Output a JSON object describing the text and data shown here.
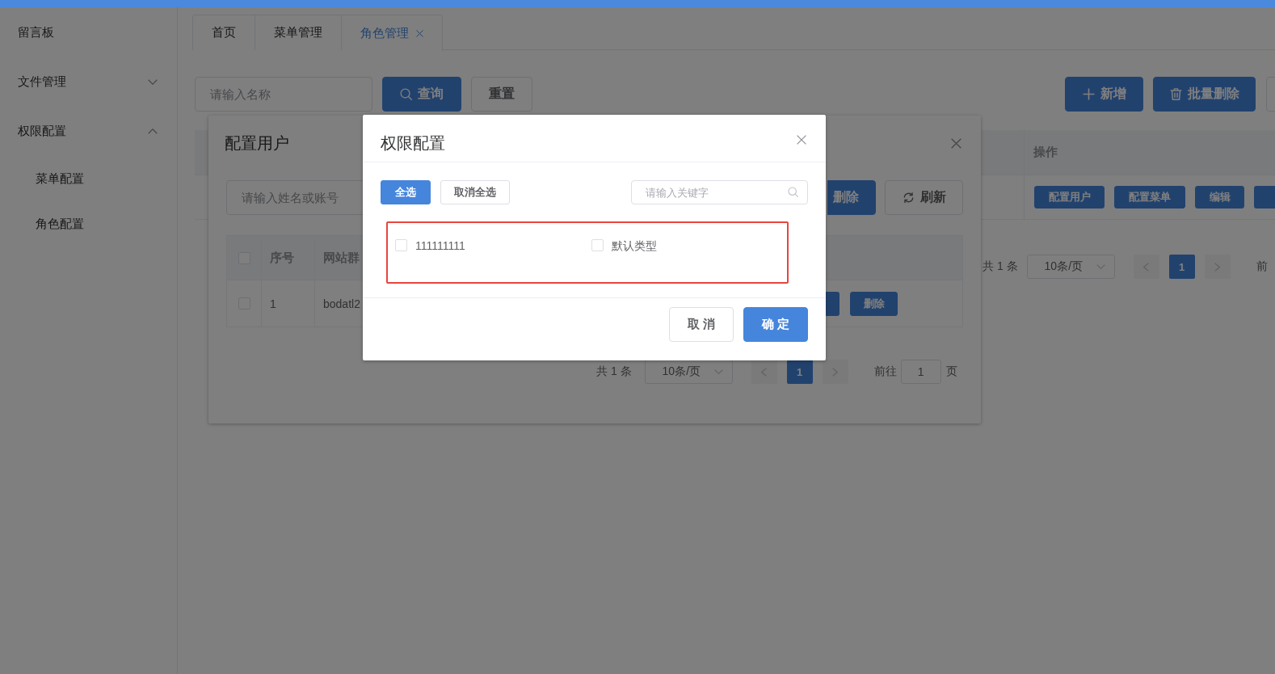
{
  "sidebar": {
    "items": [
      {
        "kind": "link",
        "label": "留言板"
      },
      {
        "kind": "submenu",
        "label": "文件管理",
        "expanded": false
      },
      {
        "kind": "submenu",
        "label": "权限配置",
        "expanded": true,
        "children": [
          {
            "label": "菜单配置"
          },
          {
            "label": "角色配置"
          }
        ]
      }
    ]
  },
  "tabs": [
    {
      "label": "首页",
      "selected": false,
      "closable": false
    },
    {
      "label": "菜单管理",
      "selected": false,
      "closable": false
    },
    {
      "label": "角色管理",
      "selected": true,
      "closable": true
    }
  ],
  "toolbar": {
    "search": {
      "placeholder": "请输入名称"
    },
    "buttons": [
      {
        "label": "查询",
        "kind": "search"
      },
      {
        "label": "重置",
        "kind": "plain"
      }
    ],
    "actions": [
      {
        "label": "新增",
        "kind": "add"
      },
      {
        "label": "批量删除",
        "kind": "delete"
      }
    ]
  },
  "table": {
    "columns": [
      "操作"
    ],
    "rows": [
      {
        "actions": [
          "配置用户",
          "配置菜单",
          "编辑"
        ]
      }
    ]
  },
  "pagination": {
    "total": "共 1 条",
    "page_size": "10条/页",
    "pages": [
      {
        "label": "1",
        "selected": true
      }
    ],
    "jump_label": "前"
  },
  "user_dialog": {
    "title": "配置用户",
    "search": {
      "placeholder": "请输入姓名或账号"
    },
    "buttons": [
      {
        "label": "删除",
        "kind": "primary"
      },
      {
        "label": "刷新",
        "kind": "refresh"
      }
    ],
    "table": {
      "header_checked": false,
      "columns": [
        "序号",
        "网站群"
      ],
      "rows": [
        {
          "checked": false,
          "cells": [
            "1",
            "bodatl2"
          ],
          "actions": [
            "删除"
          ]
        }
      ]
    },
    "pagination": {
      "total": "共 1 条",
      "page_size": "10条/页",
      "pages": [
        {
          "label": "1",
          "selected": true
        }
      ],
      "jump_label": "前往",
      "jump_value": "1",
      "jump_suffix": "页"
    }
  },
  "permission_dialog": {
    "title": "权限配置",
    "buttons": [
      {
        "label": "全选",
        "kind": "primary"
      },
      {
        "label": "取消全选",
        "kind": "plain"
      }
    ],
    "search": {
      "placeholder": "请输入关键字"
    },
    "options": [
      {
        "label": "111111111",
        "checked": false
      },
      {
        "label": "默认类型",
        "checked": false
      }
    ],
    "footer": [
      {
        "label": "取 消",
        "kind": "plain"
      },
      {
        "label": "确 定",
        "kind": "primary"
      }
    ]
  }
}
